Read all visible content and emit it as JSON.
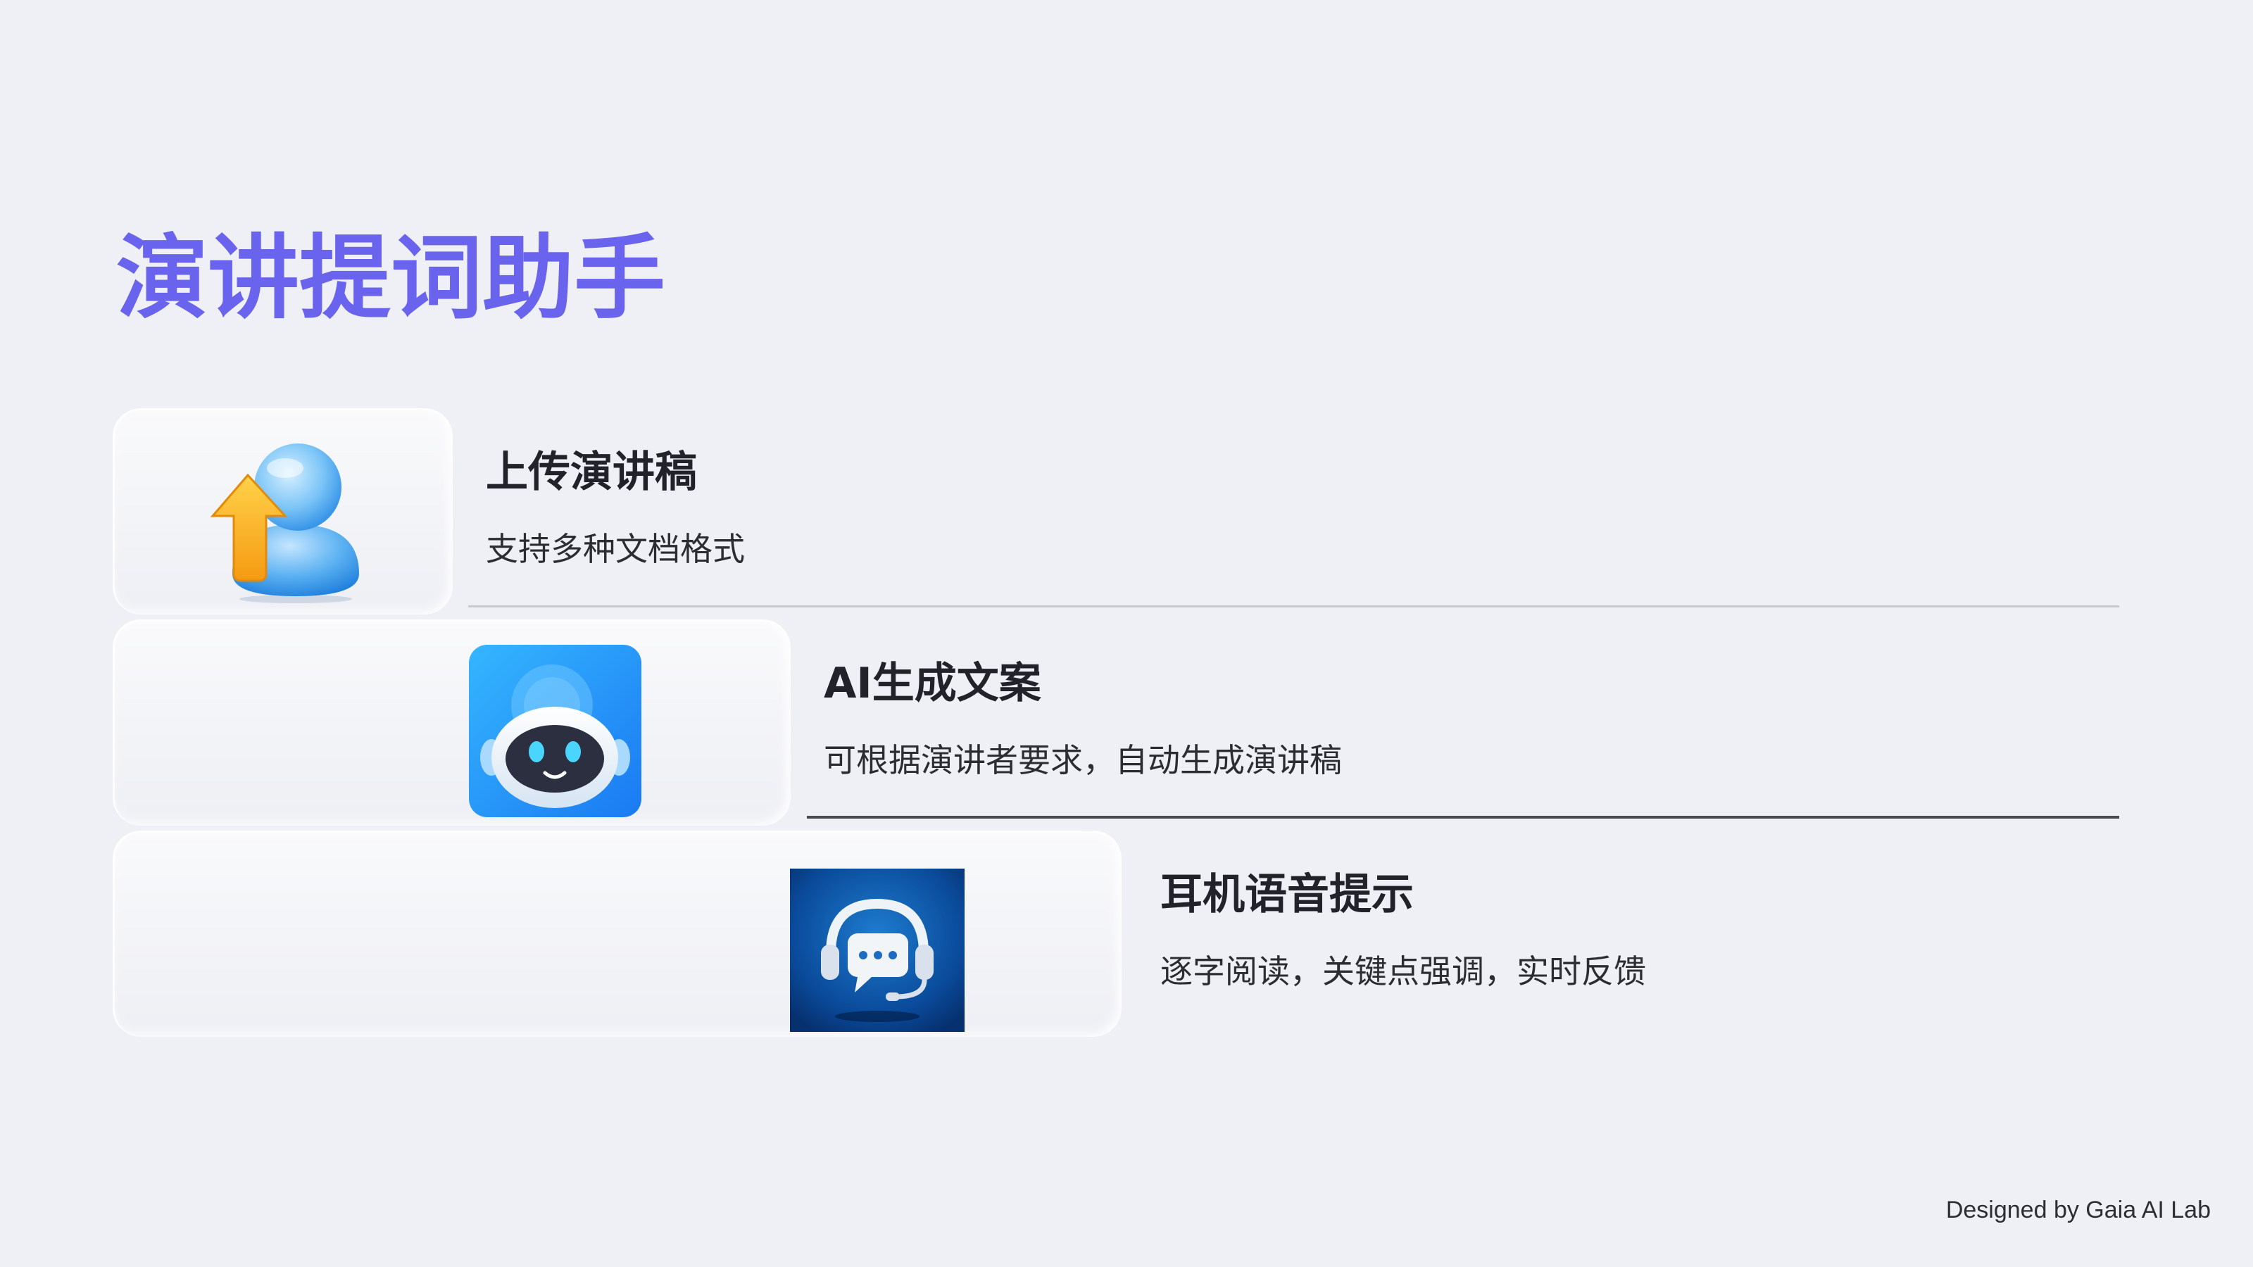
{
  "page": {
    "title": "演讲提词助手",
    "title_color": "#6a63ee",
    "background": "#eff0f5"
  },
  "features": [
    {
      "icon": "upload-user-icon",
      "title": "上传演讲稿",
      "description": "支持多种文档格式"
    },
    {
      "icon": "ai-robot-icon",
      "title": "AI生成文案",
      "description": "可根据演讲者要求，自动生成演讲稿"
    },
    {
      "icon": "headset-chat-icon",
      "title": "耳机语音提示",
      "description": "逐字阅读，关键点强调，实时反馈"
    }
  ],
  "footer": {
    "credit": "Designed by Gaia AI Lab"
  }
}
